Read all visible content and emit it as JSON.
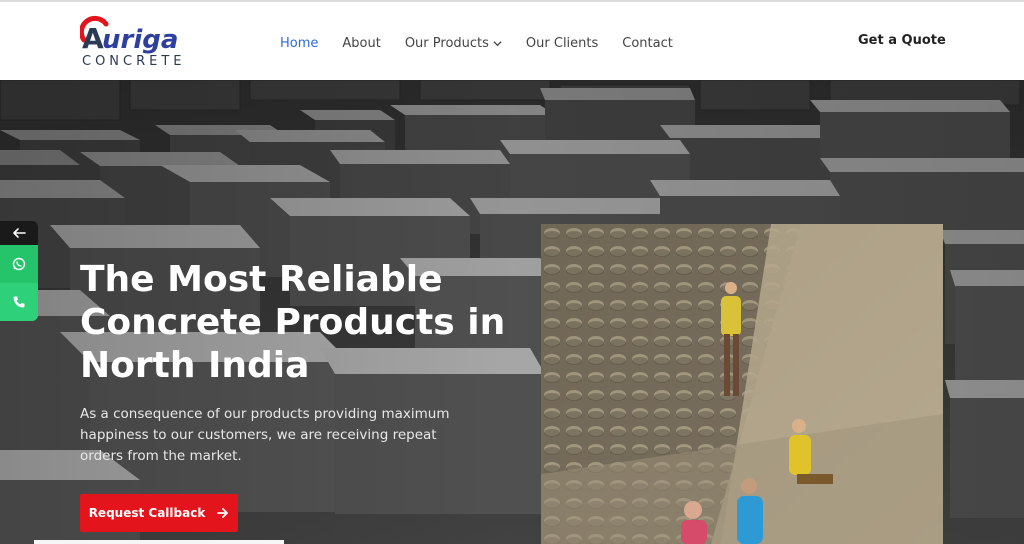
{
  "brand": {
    "name": "Auriga",
    "tagline": "CONCRETE",
    "colors": {
      "red": "#e3141c",
      "navy": "#2b3a55"
    }
  },
  "nav": {
    "items": [
      {
        "label": "Home",
        "active": true
      },
      {
        "label": "About"
      },
      {
        "label": "Our Products",
        "dropdown": true
      },
      {
        "label": "Our Clients"
      },
      {
        "label": "Contact"
      }
    ],
    "quote_label": "Get a Quote",
    "active_color": "#2f6bd8"
  },
  "hero": {
    "title": "The Most Reliable Concrete Products in North India",
    "description": "As a consequence of our products providing maximum happiness to our customers, we are receiving repeat orders from the market.",
    "cta_label": "Request Callback"
  },
  "side_bar": {
    "icons": [
      "arrow-left-icon",
      "whatsapp-icon",
      "phone-icon"
    ],
    "color": "#25c46b"
  }
}
